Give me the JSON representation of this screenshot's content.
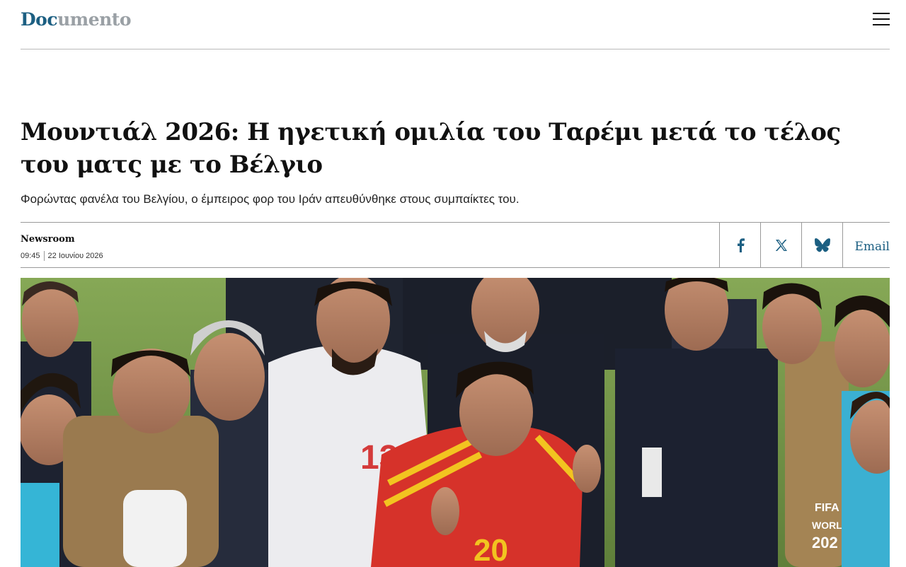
{
  "header": {
    "logo_part1": "Doc",
    "logo_part2": "umento",
    "menu_icon": "hamburger-menu-icon"
  },
  "article": {
    "title": "Μουντιάλ 2026: Η ηγετική ομιλία του Ταρέμι μετά το τέλος του ματς με το Βέλγιο",
    "subtitle": "Φορώντας φανέλα του Βελγίου, ο έμπειρος φορ του Ιράν απευθύνθηκε στους συμπαίκτες του.",
    "author": "Newsroom",
    "time": "09:45",
    "date": "22 Ιουνίου 2026"
  },
  "share": {
    "facebook_icon": "facebook-icon",
    "x_icon": "x-icon",
    "bluesky_icon": "bluesky-icon",
    "email_label": "Email"
  },
  "photo": {
    "jersey_white": "13",
    "jersey_red": "20",
    "bib_text_1": "FIFA",
    "bib_text_2": "WORLD",
    "bib_text_3": "202"
  },
  "colors": {
    "brand_blue": "#1c5f82",
    "logo_grey": "#9aa0a5"
  }
}
